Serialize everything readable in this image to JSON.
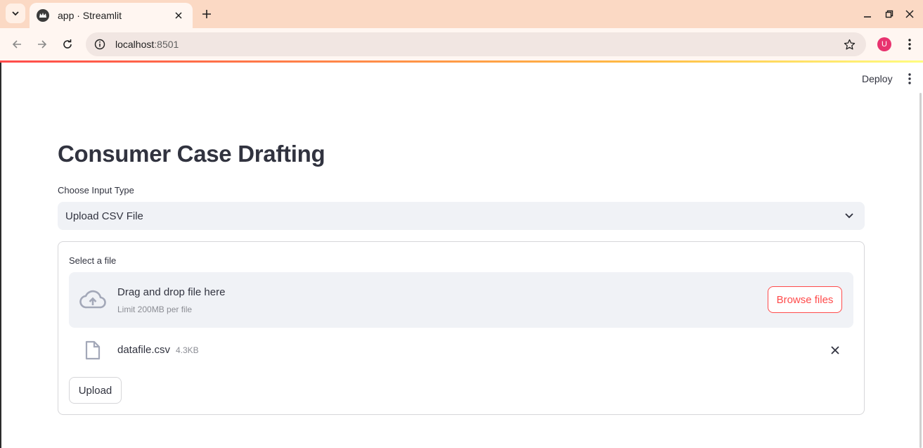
{
  "browser": {
    "tab_title": "app · Streamlit",
    "url_host": "localhost",
    "url_port": ":8501",
    "profile_initial": "U",
    "colors": {
      "tabbar": "#fbd9c4",
      "toolbar": "#fff6f1",
      "avatar": "#e8336f"
    }
  },
  "header": {
    "deploy_label": "Deploy"
  },
  "main": {
    "title": "Consumer Case Drafting",
    "input_type": {
      "label": "Choose Input Type",
      "selected": "Upload CSV File"
    },
    "uploader": {
      "label": "Select a file",
      "drop_text": "Drag and drop file here",
      "limit_text": "Limit 200MB per file",
      "browse_label": "Browse files",
      "file": {
        "name": "datafile.csv",
        "size": "4.3KB"
      }
    },
    "submit_label": "Upload"
  },
  "colors": {
    "accent": "#ff4b4b",
    "text": "#31333f",
    "muted": "#8b8d94",
    "widget_bg": "#f0f2f6"
  }
}
